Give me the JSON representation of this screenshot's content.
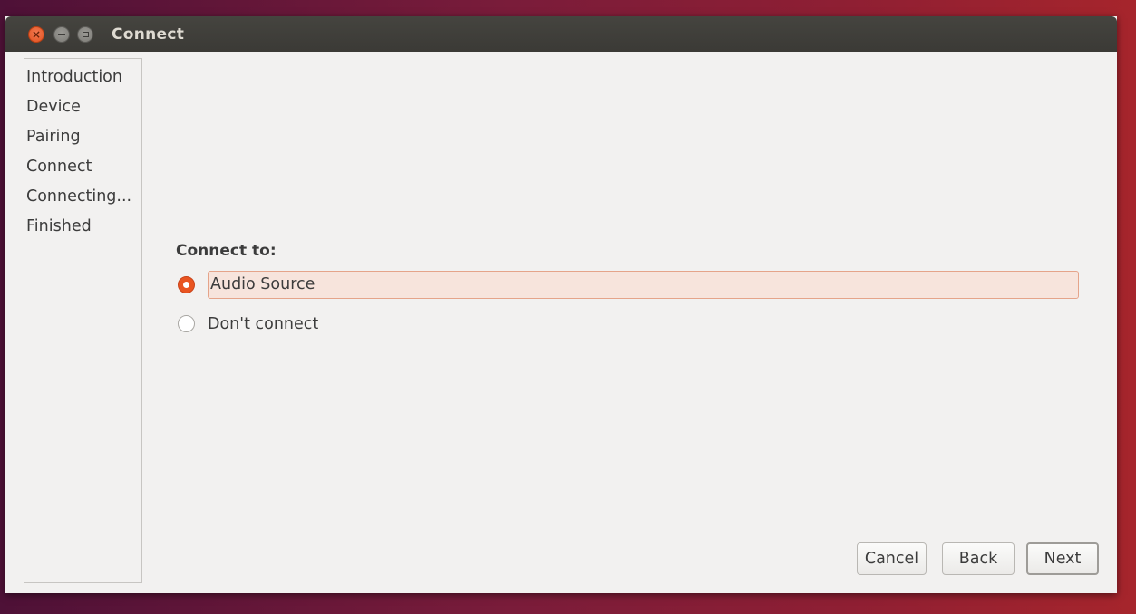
{
  "window": {
    "title": "Connect",
    "controls": {
      "close_icon": "close-icon",
      "minimize_icon": "minimize-icon",
      "maximize_icon": "maximize-icon",
      "close_glyph": "×"
    }
  },
  "sidebar": {
    "items": [
      {
        "label": "Introduction"
      },
      {
        "label": "Device"
      },
      {
        "label": "Pairing"
      },
      {
        "label": "Connect"
      },
      {
        "label": "Connecting..."
      },
      {
        "label": "Finished"
      }
    ]
  },
  "main": {
    "heading": "Connect to:",
    "options": [
      {
        "label": "Audio Source",
        "selected": true
      },
      {
        "label": "Don't connect",
        "selected": false
      }
    ]
  },
  "buttons": {
    "cancel": "Cancel",
    "back": "Back",
    "next": "Next"
  },
  "colors": {
    "accent": "#e95420",
    "titlebar": "#3c3b37",
    "window_bg": "#f2f1f0"
  }
}
